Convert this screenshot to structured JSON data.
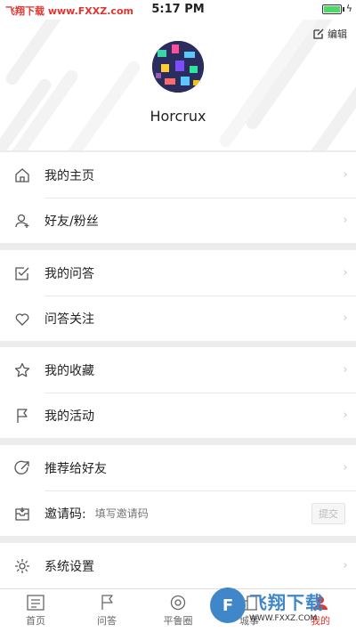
{
  "status_bar": {
    "watermark": "飞翔下载 www.FXXZ.com",
    "time": "5:17 PM"
  },
  "header": {
    "edit_label": "编辑",
    "username": "Horcrux"
  },
  "menu": {
    "my_homepage": "我的主页",
    "friends_fans": "好友/粉丝",
    "my_qa": "我的问答",
    "qa_follow": "问答关注",
    "my_favorites": "我的收藏",
    "my_activities": "我的活动",
    "recommend": "推荐给好友",
    "invite_label": "邀请码:",
    "invite_placeholder": "填写邀请码",
    "invite_submit": "提交",
    "settings": "系统设置",
    "arrow": "›"
  },
  "tabbar": {
    "home": "首页",
    "qa": "问答",
    "community": "平鲁圈",
    "events": "城事",
    "mine": "我的"
  },
  "watermark_bottom": {
    "logo": "F",
    "name": "飞翔下载",
    "url": "WWW.FXXZ.COM"
  },
  "colors": {
    "accent": "#e0342f",
    "battery": "#4cd964",
    "watermark_blue": "#3f87c9"
  }
}
